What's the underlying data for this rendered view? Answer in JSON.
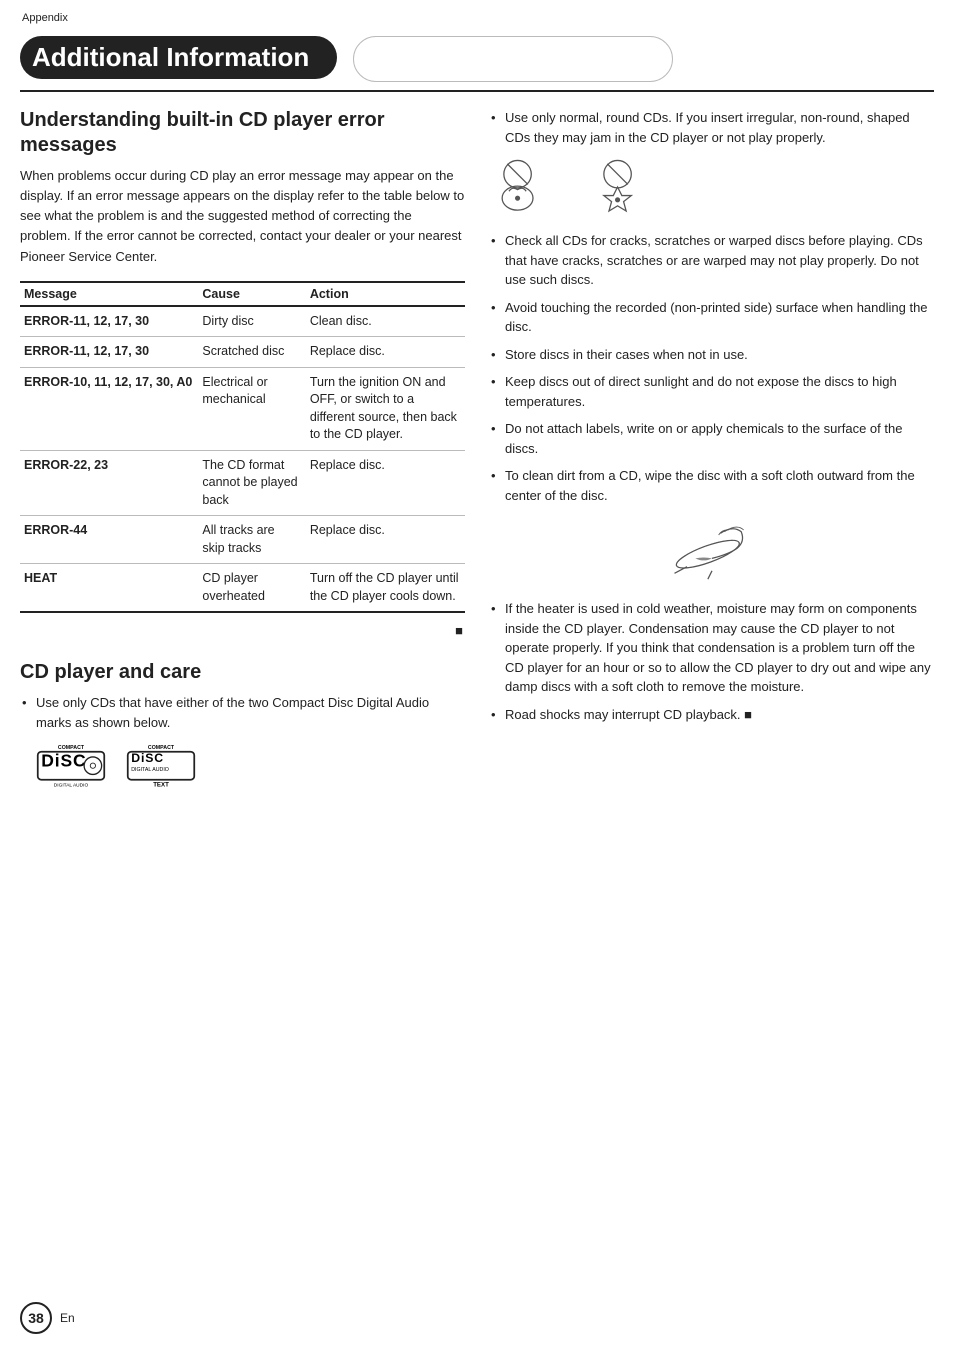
{
  "header": {
    "appendix": "Appendix",
    "title": "Additional Information",
    "page_number": "38",
    "en": "En"
  },
  "error_section": {
    "heading": "Understanding built-in CD player error messages",
    "intro": "When problems occur during CD play an error message may appear on the display. If an error message appears on the display refer to the table below to see what the problem is and the suggested method of correcting the problem. If the error cannot be corrected, contact your dealer or your nearest Pioneer Service Center.",
    "table": {
      "columns": [
        "Message",
        "Cause",
        "Action"
      ],
      "rows": [
        {
          "message": "ERROR-11, 12, 17, 30",
          "cause": "Dirty disc",
          "action": "Clean disc."
        },
        {
          "message": "ERROR-11, 12, 17, 30",
          "cause": "Scratched disc",
          "action": "Replace disc."
        },
        {
          "message": "ERROR-10, 11, 12, 17, 30, A0",
          "cause": "Electrical or mechanical",
          "action": "Turn the ignition ON and OFF, or switch to a different source, then back to the CD player."
        },
        {
          "message": "ERROR-22, 23",
          "cause": "The CD format cannot be played back",
          "action": "Replace disc."
        },
        {
          "message": "ERROR-44",
          "cause": "All tracks are skip tracks",
          "action": "Replace disc."
        },
        {
          "message": "HEAT",
          "cause": "CD player overheated",
          "action": "Turn off the CD player until the CD player cools down."
        }
      ]
    }
  },
  "cd_care_section": {
    "heading": "CD player and care",
    "bullets": [
      "Use only CDs that have either of the two Compact Disc Digital Audio marks as shown below.",
      "Use only normal, round CDs. If you insert irregular, non-round, shaped CDs they may jam in the CD player or not play properly.",
      "Check all CDs for cracks, scratches or warped discs before playing. CDs that have cracks, scratches or are warped may not play properly. Do not use such discs.",
      "Avoid touching the recorded (non-printed side) surface when handling the disc.",
      "Store discs in their cases when not in use.",
      "Keep discs out of direct sunlight and do not expose the discs to high temperatures.",
      "Do not attach labels, write on or apply chemicals to the surface of the discs.",
      "To clean dirt from a CD, wipe the disc with a soft cloth outward from the center of the disc.",
      "If the heater is used in cold weather, moisture may form on components inside the CD player. Condensation may cause the CD player to not operate properly. If you think that condensation is a problem turn off the CD player for an hour or so to allow the CD player to dry out and wipe any damp discs with a soft cloth to remove the moisture.",
      "Road shocks may interrupt CD playback. ■"
    ],
    "cd_logos_label1_top": "COMPACT",
    "cd_logos_label1_mid": "DISC",
    "cd_logos_label1_bot": "DIGITAL AUDIO",
    "cd_logos_label2_top": "COMPACT",
    "cd_logos_label2_mid": "DISC",
    "cd_logos_label2_sub": "DIGITAL AUDIO",
    "cd_logos_label2_text": "TEXT"
  },
  "icons": {
    "end_marker": "■"
  }
}
